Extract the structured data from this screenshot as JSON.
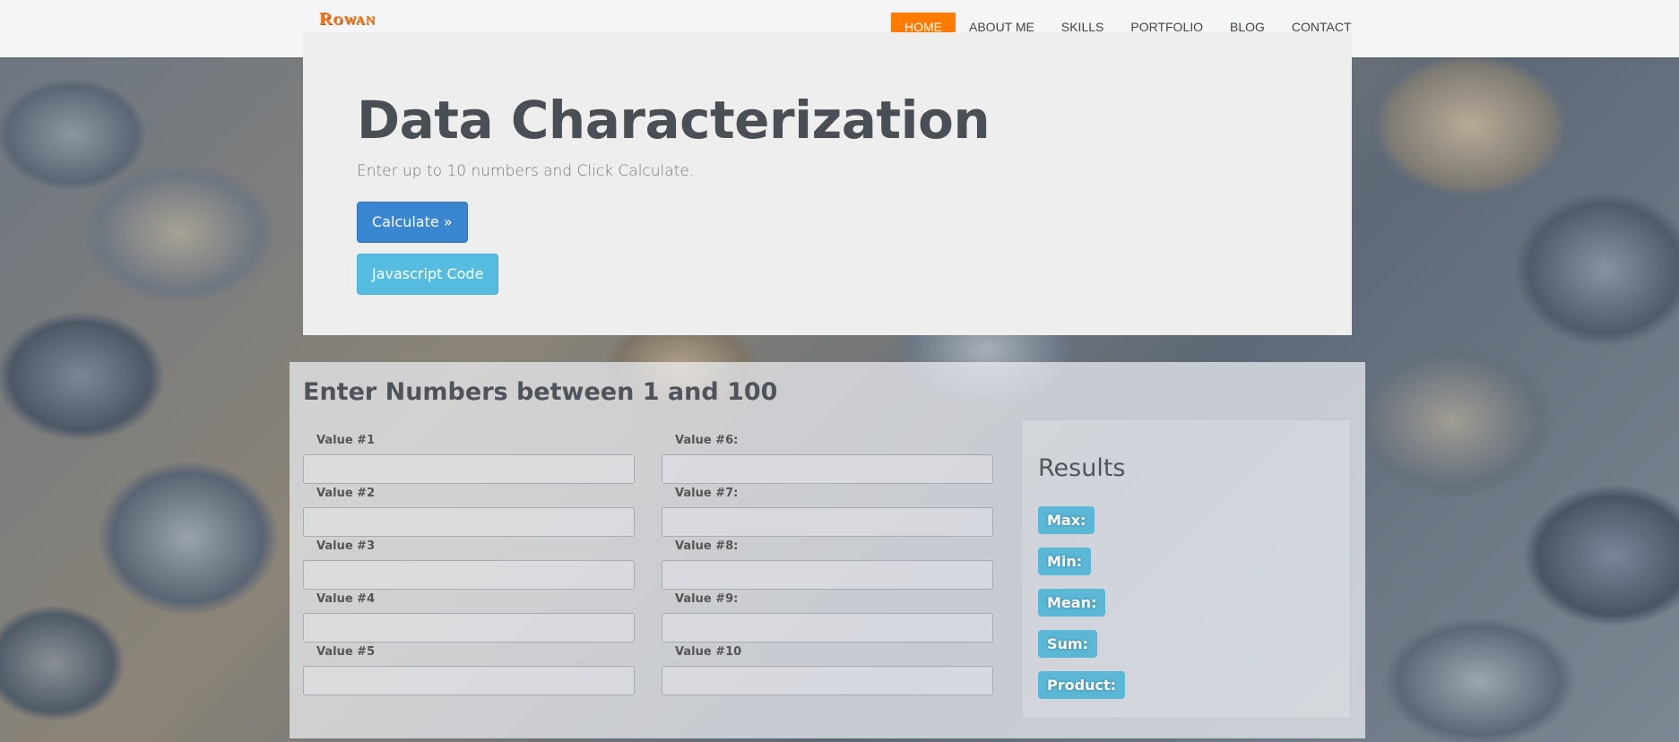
{
  "header": {
    "logo": "Rowan",
    "nav": [
      {
        "label": "HOME",
        "active": true
      },
      {
        "label": "ABOUT ME",
        "active": false
      },
      {
        "label": "SKILLS",
        "active": false
      },
      {
        "label": "PORTFOLIO",
        "active": false
      },
      {
        "label": "BLOG",
        "active": false
      },
      {
        "label": "CONTACT",
        "active": false
      }
    ],
    "active_color": "#ff7a00"
  },
  "jumbotron": {
    "title": "Data Characterization",
    "lead": "Enter up to 10 numbers and Click Calculate.",
    "calculate_button": "Calculate »",
    "js_button": "Javascript Code"
  },
  "form": {
    "heading": "Enter Numbers between 1 and 100",
    "fields": [
      {
        "label": "Value #1",
        "value": ""
      },
      {
        "label": "Value #2",
        "value": ""
      },
      {
        "label": "Value #3",
        "value": ""
      },
      {
        "label": "Value #4",
        "value": ""
      },
      {
        "label": "Value #5",
        "value": ""
      },
      {
        "label": "Value #6:",
        "value": ""
      },
      {
        "label": "Value #7:",
        "value": ""
      },
      {
        "label": "Value #8:",
        "value": ""
      },
      {
        "label": "Value #9:",
        "value": ""
      },
      {
        "label": "Value #10",
        "value": ""
      }
    ]
  },
  "results": {
    "heading": "Results",
    "badges": [
      "Max:",
      "Min:",
      "Mean:",
      "Sum:",
      "Product:"
    ],
    "badge_color": "#5ab8d6"
  },
  "colors": {
    "primary_button": "#3b86d1",
    "info_button": "#56bde0"
  }
}
